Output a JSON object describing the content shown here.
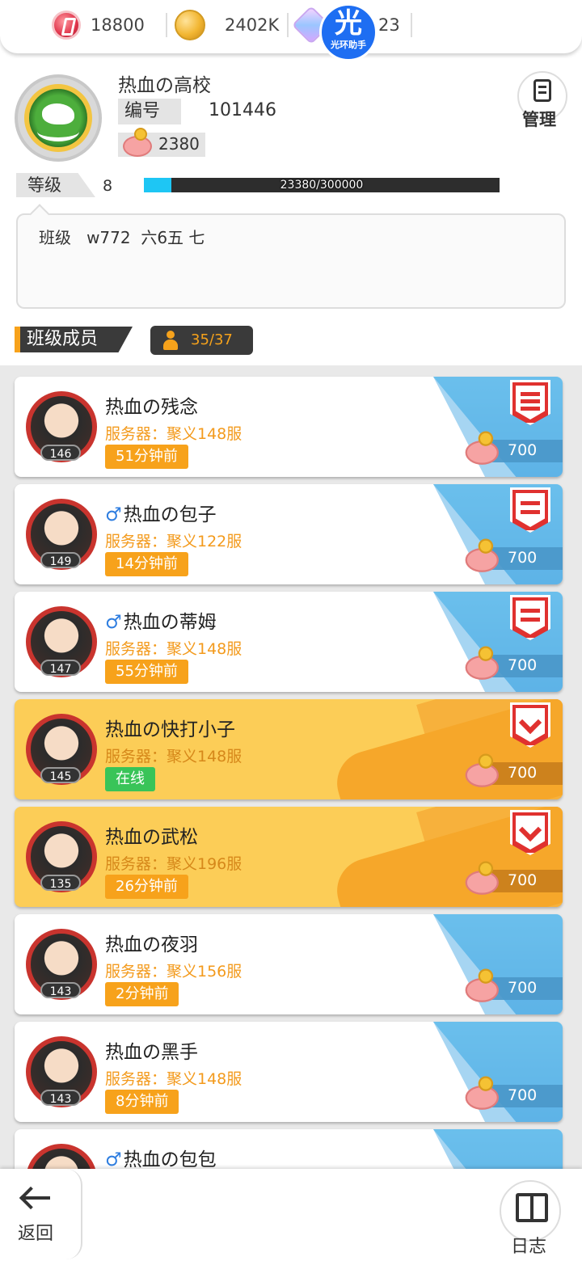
{
  "resources": [
    {
      "icon": "red-diamond-icon",
      "value": "18800"
    },
    {
      "icon": "gold-coin-icon",
      "value": "2402K"
    },
    {
      "icon": "crystal-icon",
      "value": "23"
    }
  ],
  "overlay_badge": {
    "char": "光",
    "text": "光环助手"
  },
  "club": {
    "name": "热血の高校",
    "id_label": "编号",
    "id_value": "101446",
    "piggy_value": "2380",
    "level_label": "等级",
    "level_value": "8",
    "xp_text": "23380/300000",
    "xp_progress": 0.0779,
    "description": "班级   w772  六6五 七"
  },
  "manage_label": "管理",
  "members_title": "班级成员",
  "member_count": "35/37",
  "members": [
    {
      "name": "热血の残念",
      "male": "",
      "server": "服务器：聚义148服",
      "time": "51分钟前",
      "level": "146",
      "piggy": "700",
      "online": false,
      "gold": false,
      "role": "captain"
    },
    {
      "name": "热血の包子",
      "male": "♂",
      "server": "服务器：聚义122服",
      "time": "14分钟前",
      "level": "149",
      "piggy": "700",
      "online": false,
      "gold": false,
      "role": "officer"
    },
    {
      "name": "热血の蒂姆",
      "male": "♂",
      "server": "服务器：聚义148服",
      "time": "55分钟前",
      "level": "147",
      "piggy": "700",
      "online": false,
      "gold": false,
      "role": "officer"
    },
    {
      "name": "热血の快打小子",
      "male": "",
      "server": "服务器：聚义148服",
      "time": "在线",
      "level": "145",
      "piggy": "700",
      "online": true,
      "gold": true,
      "role": "vip"
    },
    {
      "name": "热血の武松",
      "male": "",
      "server": "服务器：聚义196服",
      "time": "26分钟前",
      "level": "135",
      "piggy": "700",
      "online": false,
      "gold": true,
      "role": "vip"
    },
    {
      "name": "热血の夜羽",
      "male": "",
      "server": "服务器：聚义156服",
      "time": "2分钟前",
      "level": "143",
      "piggy": "700",
      "online": false,
      "gold": false,
      "role": "none"
    },
    {
      "name": "热血の黑手",
      "male": "",
      "server": "服务器：聚义148服",
      "time": "8分钟前",
      "level": "143",
      "piggy": "700",
      "online": false,
      "gold": false,
      "role": "none"
    },
    {
      "name": "热血の包包",
      "male": "♂",
      "server": "",
      "time": "",
      "level": "",
      "piggy": "",
      "online": false,
      "gold": false,
      "role": "none"
    }
  ],
  "nav": {
    "back_label": "返回",
    "log_label": "日志"
  },
  "colors": {
    "accent_orange": "#f7a21b",
    "xp_blue": "#1ec6f4",
    "online_green": "#39c458",
    "captain_red": "#e0312f"
  }
}
